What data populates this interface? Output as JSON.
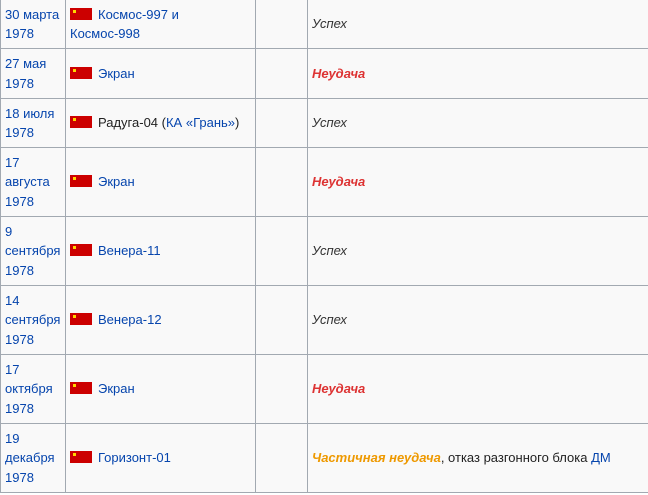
{
  "flag_icon": "ussr-flag-icon",
  "colors": {
    "link": "#0645ad",
    "failure": "#dd3333",
    "partial_failure": "#ee9900",
    "border": "#a2a9b1",
    "row_background": "#f9f9f9"
  },
  "rows": [
    {
      "date": [
        "30 марта",
        "1978"
      ],
      "payload": [
        "Космос-997 и",
        "Космос-998"
      ],
      "status": "Успех"
    },
    {
      "date": [
        "27 мая",
        "1978"
      ],
      "payload": [
        "Экран"
      ],
      "status": "Неудача"
    },
    {
      "date": [
        "18 июля",
        "1978"
      ],
      "payload_plain": "Радуга-04 (",
      "payload_link": "КА «Грань»",
      "payload_close": ")",
      "status": "Успех"
    },
    {
      "date": [
        "17",
        "августа",
        "1978"
      ],
      "payload": [
        "Экран"
      ],
      "status": "Неудача"
    },
    {
      "date": [
        "9",
        "сентября",
        "1978"
      ],
      "payload": [
        "Венера-11"
      ],
      "status": "Успех"
    },
    {
      "date": [
        "14",
        "сентября",
        "1978"
      ],
      "payload": [
        "Венера-12"
      ],
      "status": "Успех"
    },
    {
      "date": [
        "17",
        "октября",
        "1978"
      ],
      "payload": [
        "Экран"
      ],
      "status": "Неудача"
    },
    {
      "date": [
        "19",
        "декабря",
        "1978"
      ],
      "payload": [
        "Горизонт-01"
      ],
      "status": "Частичная неудача",
      "status_note": ", отказ разгонного блока ",
      "status_link": "ДМ"
    }
  ]
}
